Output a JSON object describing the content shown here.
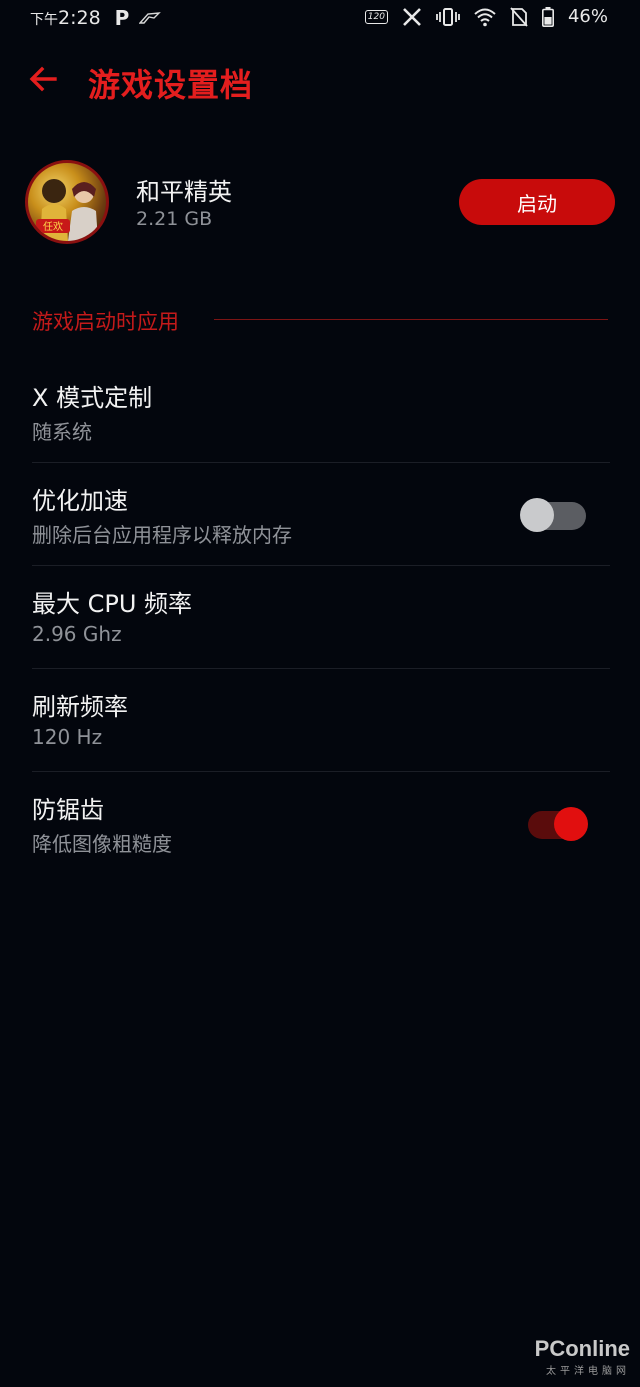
{
  "status_bar": {
    "time_prefix": "下午",
    "time": "2:28",
    "p_label": "P",
    "refresh_badge": "120",
    "battery_percent": "46%"
  },
  "header": {
    "title": "游戏设置档"
  },
  "game": {
    "name": "和平精英",
    "size": "2.21 GB",
    "launch_label": "启动",
    "avatar_text": "任欢"
  },
  "section": {
    "title": "游戏启动时应用"
  },
  "settings": [
    {
      "title": "X 模式定制",
      "subtitle": "随系统"
    },
    {
      "title": "优化加速",
      "subtitle": "删除后台应用程序以释放内存",
      "toggle": "off"
    },
    {
      "title": "最大 CPU 频率",
      "subtitle": "2.96 Ghz"
    },
    {
      "title": "刷新频率",
      "subtitle": "120 Hz"
    },
    {
      "title": "防锯齿",
      "subtitle": "降低图像粗糙度",
      "toggle": "on"
    }
  ],
  "watermark": {
    "brand": "PConline",
    "sub": "太平洋电脑网"
  },
  "colors": {
    "background": "#03060d",
    "accent": "#e41e1e",
    "launch_button": "#c80b0b",
    "subtitle_gray": "#8f9298"
  }
}
